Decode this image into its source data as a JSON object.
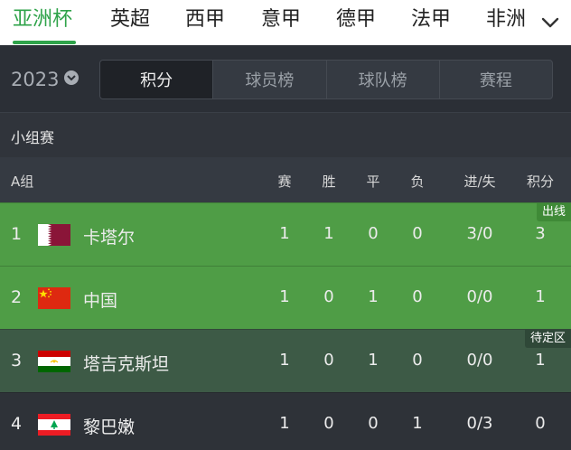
{
  "nav": {
    "tabs": [
      "亚洲杯",
      "英超",
      "西甲",
      "意甲",
      "德甲",
      "法甲",
      "非洲"
    ],
    "active_index": 0,
    "accent_color": "#2fa34a",
    "more_icon": "chevron-down-icon"
  },
  "toolbar": {
    "year": "2023",
    "year_icon": "dropdown-circle-icon",
    "segments": [
      "积分",
      "球员榜",
      "球队榜",
      "赛程"
    ],
    "active_segment": 0
  },
  "section": {
    "title": "小组赛"
  },
  "table": {
    "group": "A组",
    "columns": [
      "赛",
      "胜",
      "平",
      "负",
      "进/失",
      "积分"
    ],
    "rows": [
      {
        "rank": "1",
        "flag": "qatar-flag-icon",
        "team": "卡塔尔",
        "values": [
          "1",
          "1",
          "0",
          "0",
          "3/0",
          "3"
        ],
        "badge": "出线",
        "row_color": "#4f9d46",
        "badge_color": "#3f8a37"
      },
      {
        "rank": "2",
        "flag": "china-flag-icon",
        "team": "中国",
        "values": [
          "1",
          "0",
          "1",
          "0",
          "0/0",
          "1"
        ],
        "badge": "",
        "row_color": "#4f9d46",
        "badge_color": ""
      },
      {
        "rank": "3",
        "flag": "tajikistan-flag-icon",
        "team": "塔吉克斯坦",
        "values": [
          "1",
          "0",
          "1",
          "0",
          "0/0",
          "1"
        ],
        "badge": "待定区",
        "row_color": "#3d5a46",
        "badge_color": "#2f4838"
      },
      {
        "rank": "4",
        "flag": "lebanon-flag-icon",
        "team": "黎巴嫩",
        "values": [
          "1",
          "0",
          "0",
          "1",
          "0/3",
          "0"
        ],
        "badge": "",
        "row_color": "#2e3238",
        "badge_color": ""
      }
    ]
  }
}
